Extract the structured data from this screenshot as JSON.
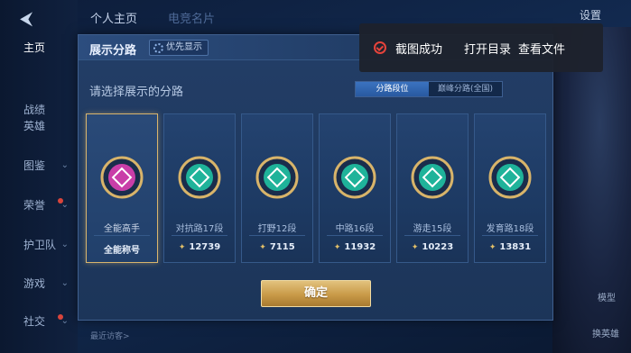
{
  "top_tabs": [
    "个人主页",
    "电竞名片"
  ],
  "settings_label": "设置",
  "sidebar": {
    "items": [
      {
        "label": "主页",
        "active": true,
        "chevron": false,
        "badge": false
      },
      {
        "label": "战绩",
        "active": false,
        "chevron": false,
        "badge": false
      },
      {
        "label": "英雄",
        "active": false,
        "chevron": false,
        "badge": false
      },
      {
        "label": "图鉴",
        "active": false,
        "chevron": true,
        "badge": false
      },
      {
        "label": "荣誉",
        "active": false,
        "chevron": true,
        "badge": true
      },
      {
        "label": "护卫队",
        "active": false,
        "chevron": true,
        "badge": false
      },
      {
        "label": "游戏",
        "active": false,
        "chevron": true,
        "badge": false
      },
      {
        "label": "社交",
        "active": false,
        "chevron": true,
        "badge": true
      }
    ]
  },
  "right_buttons": {
    "model": "模型",
    "hero": "换英雄"
  },
  "visitor_text": "最近访客>",
  "dialog": {
    "title": "展示分路",
    "priority_label": "优先显示",
    "prompt": "请选择展示的分路",
    "toggle": {
      "left": "分路段位",
      "right": "巅峰分路(全国)",
      "selected": "left"
    },
    "confirm_label": "确定",
    "cards": [
      {
        "label": "全能高手",
        "score": "全能称号",
        "selected": true,
        "emblem_color": "#c93ea8",
        "emblem_icon": "all-round-icon"
      },
      {
        "label": "对抗路17段",
        "score": "12739",
        "selected": false,
        "emblem_color": "#1fb39a",
        "emblem_icon": "clash-lane-icon"
      },
      {
        "label": "打野12段",
        "score": "7115",
        "selected": false,
        "emblem_color": "#1fb39a",
        "emblem_icon": "jungle-icon"
      },
      {
        "label": "中路16段",
        "score": "11932",
        "selected": false,
        "emblem_color": "#1fb39a",
        "emblem_icon": "mid-lane-icon"
      },
      {
        "label": "游走15段",
        "score": "10223",
        "selected": false,
        "emblem_color": "#1fb39a",
        "emblem_icon": "roam-icon"
      },
      {
        "label": "发育路18段",
        "score": "13831",
        "selected": false,
        "emblem_color": "#1fb39a",
        "emblem_icon": "farm-lane-icon"
      }
    ]
  },
  "toast": {
    "message": "截图成功",
    "open_dir": "打开目录",
    "view_file": "查看文件",
    "accent": "#e5433b"
  }
}
